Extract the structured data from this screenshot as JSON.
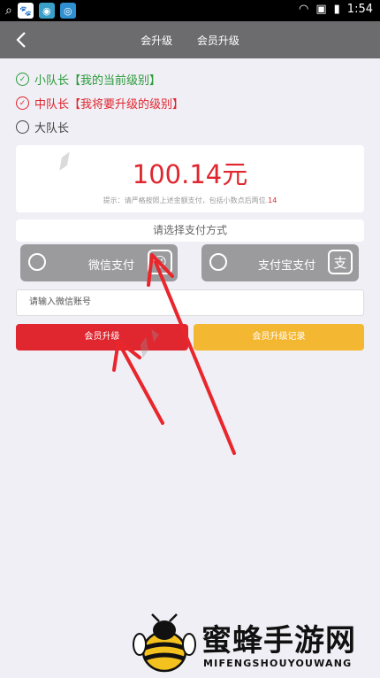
{
  "status": {
    "time": "1:54"
  },
  "header": {
    "tab1": "会升级",
    "tab2": "会员升级"
  },
  "options": [
    {
      "label": "小队长",
      "note": "【我的当前级别】",
      "color": "#2a9a3a",
      "checked": true
    },
    {
      "label": "中队长",
      "note": "【我将要升级的级别】",
      "color": "#e0262f",
      "checked": true
    },
    {
      "label": "大队长",
      "note": "",
      "color": "#444444",
      "checked": false
    }
  ],
  "amount": "100.14元",
  "hint": {
    "text": "提示：请严格按照上述金额支付，包括小数点后两位.",
    "tail": "14"
  },
  "pay": {
    "title": "请选择支付方式",
    "wechat": "微信支付",
    "alipay": "支付宝支付"
  },
  "wechat_input": {
    "placeholder": "请输入微信账号"
  },
  "buttons": {
    "upgrade": "会员升级",
    "record": "会员升级记录"
  },
  "colors": {
    "red": "#e0262f",
    "orange": "#f4b731"
  },
  "watermark": {
    "brand": "蜜蜂手游网",
    "sub": "MIFENGSHOUYOUWANG"
  }
}
